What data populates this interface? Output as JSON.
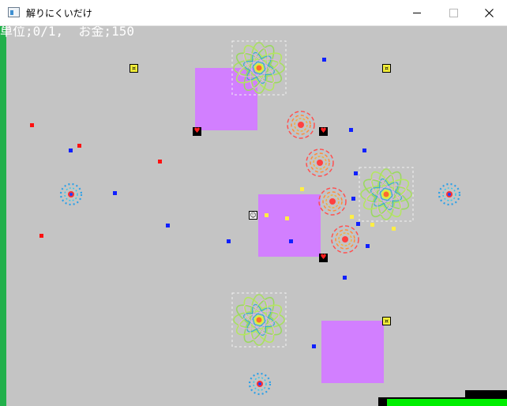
{
  "window": {
    "title": "解りにくいだけ",
    "controls": {
      "minimize_icon": "minimize-icon",
      "maximize_icon": "maximize-icon",
      "close_icon": "close-icon"
    }
  },
  "hud": {
    "status_text": "単位;0/1,  お金;150"
  },
  "colors": {
    "playfield_bg": "#c4c4c4",
    "block": "#d27fff",
    "left_bar": "#22b04b",
    "hp_fill": "#00ee00",
    "enemy_dot": "#1020ff",
    "bullet_dot": "#ff1010",
    "coin_dot": "#ffee44"
  },
  "player": {
    "hp_fraction": 0.93
  },
  "items": {
    "gold_icon": "coin-icon",
    "heart_icon": "heart-icon",
    "face_icon": "smiley-face-icon",
    "heart_glyph": "♥",
    "face_glyph": "☺",
    "gold_glyph": "¤"
  }
}
